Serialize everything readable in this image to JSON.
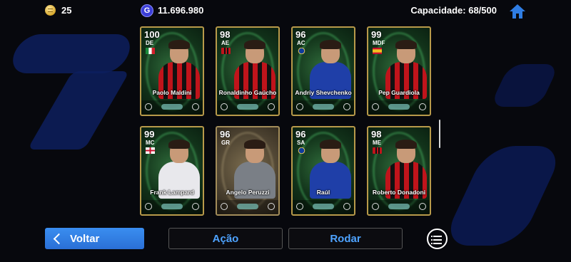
{
  "top": {
    "coins": "25",
    "gp": "11.696.980",
    "gp_icon": "G",
    "capacity": "Capacidade: 68/500"
  },
  "cards": [
    {
      "rating": "100",
      "position": "DE",
      "name": "Paolo Maldini",
      "kit": "milan",
      "flag": "italy"
    },
    {
      "rating": "98",
      "position": "AE",
      "name": "Ronaldinho Gaúcho",
      "kit": "milan",
      "flag": "milan"
    },
    {
      "rating": "96",
      "position": "AC",
      "name": "Andriy Shevchenko",
      "kit": "blue",
      "flag": "club"
    },
    {
      "rating": "99",
      "position": "MDF",
      "name": "Pep Guardiola",
      "kit": "milan",
      "flag": "spain"
    },
    {
      "rating": "99",
      "position": "MC",
      "name": "Frank Lampard",
      "kit": "white",
      "flag": "england"
    },
    {
      "rating": "96",
      "position": "GR",
      "name": "Angelo Peruzzi",
      "kit": "gray",
      "flag": "none"
    },
    {
      "rating": "96",
      "position": "SA",
      "name": "Raúl",
      "kit": "blue",
      "flag": "club"
    },
    {
      "rating": "98",
      "position": "ME",
      "name": "Roberto Donadoni",
      "kit": "milan",
      "flag": "milan"
    }
  ],
  "buttons": {
    "back": "Voltar",
    "action": "Ação",
    "rotate": "Rodar"
  },
  "colors": {
    "accent": "#2f7de3",
    "link_text": "#4ea3ff",
    "card_border": "#b89a4a"
  }
}
